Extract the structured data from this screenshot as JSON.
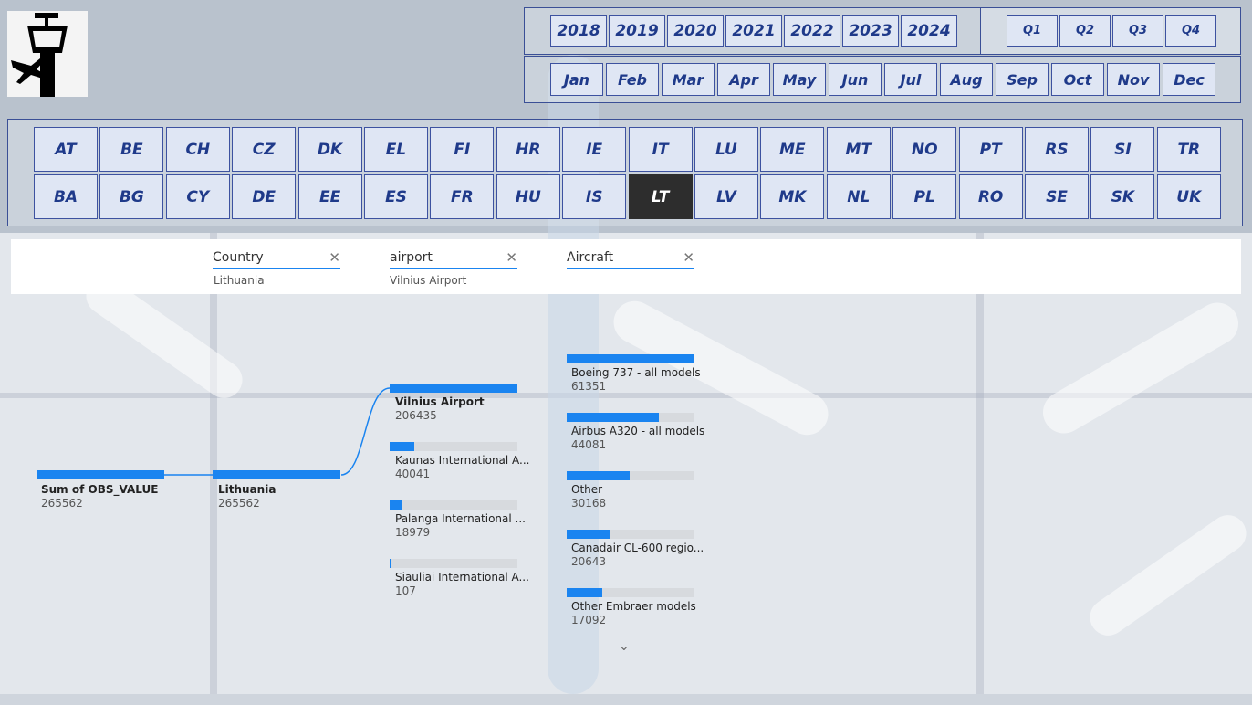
{
  "years": [
    "2018",
    "2019",
    "2020",
    "2021",
    "2022",
    "2023",
    "2024"
  ],
  "quarters": [
    "Q1",
    "Q2",
    "Q3",
    "Q4"
  ],
  "months": [
    "Jan",
    "Feb",
    "Mar",
    "Apr",
    "May",
    "Jun",
    "Jul",
    "Aug",
    "Sep",
    "Oct",
    "Nov",
    "Dec"
  ],
  "countries_row1": [
    "AT",
    "BE",
    "CH",
    "CZ",
    "DK",
    "EL",
    "FI",
    "HR",
    "IE",
    "IT",
    "LU",
    "ME",
    "MT",
    "NO",
    "PT",
    "RS",
    "SI",
    "TR"
  ],
  "countries_row2": [
    "BA",
    "BG",
    "CY",
    "DE",
    "EE",
    "ES",
    "FR",
    "HU",
    "IS",
    "LT",
    "LV",
    "MK",
    "NL",
    "PL",
    "RO",
    "SE",
    "SK",
    "UK"
  ],
  "selected_country": "LT",
  "filters": [
    {
      "label": "Country",
      "value": "Lithuania"
    },
    {
      "label": "airport",
      "value": "Vilnius Airport"
    },
    {
      "label": "Aircraft",
      "value": ""
    }
  ],
  "tree": {
    "root": {
      "label": "Sum of OBS_VALUE",
      "value": "265562"
    },
    "country": {
      "label": "Lithuania",
      "value": "265562"
    },
    "airports": [
      {
        "label": "Vilnius Airport",
        "value": "206435"
      },
      {
        "label": "Kaunas International A...",
        "value": "40041"
      },
      {
        "label": "Palanga International ...",
        "value": "18979"
      },
      {
        "label": "Siauliai International A...",
        "value": "107"
      }
    ],
    "aircraft": [
      {
        "label": "Boeing 737 - all models",
        "value": "61351"
      },
      {
        "label": "Airbus A320 - all models",
        "value": "44081"
      },
      {
        "label": "Other",
        "value": "30168"
      },
      {
        "label": "Canadair CL-600 regio...",
        "value": "20643"
      },
      {
        "label": "Other Embraer models",
        "value": "17092"
      }
    ]
  },
  "colors": {
    "accent": "#1a84f0",
    "button_bg": "#dfe6f4",
    "button_text": "#1f3a8a",
    "selected_bg": "#2d2d2d"
  },
  "icons": {
    "logo": "control-tower-plane-icon",
    "clear": "close-icon",
    "more": "chevron-down-icon"
  }
}
